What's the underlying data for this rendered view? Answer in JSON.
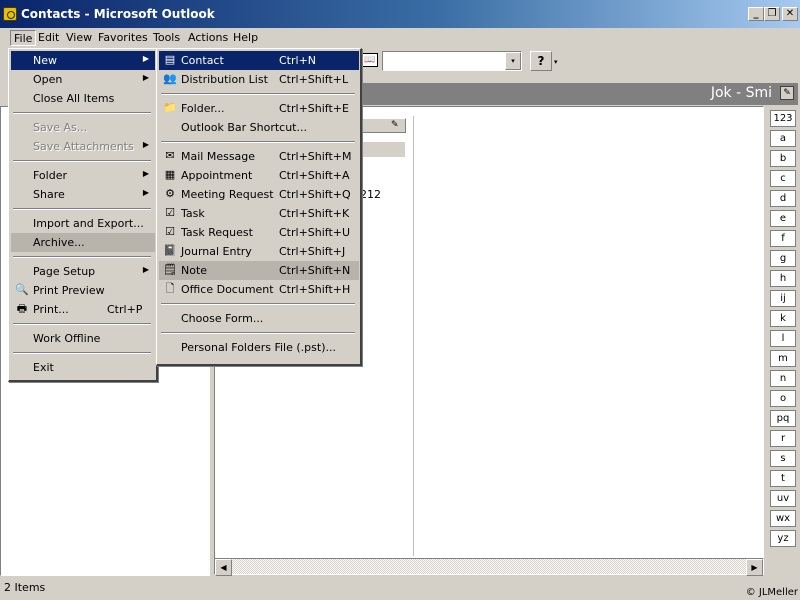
{
  "window": {
    "title": "Contacts - Microsoft Outlook",
    "min": "_",
    "max": "❐",
    "close": "✕"
  },
  "menubar": [
    "File",
    "Edit",
    "View",
    "Favorites",
    "Tools",
    "Actions",
    "Help"
  ],
  "toolbar": {
    "dropdown_arrow": "▾"
  },
  "banner": {
    "title": "Jok - Smi"
  },
  "card": {
    "phone": "212"
  },
  "index": [
    "123",
    "a",
    "b",
    "c",
    "d",
    "e",
    "f",
    "g",
    "h",
    "ij",
    "k",
    "l",
    "m",
    "n",
    "o",
    "pq",
    "r",
    "s",
    "t",
    "uv",
    "wx",
    "yz"
  ],
  "scroll": {
    "left": "◀",
    "right": "▶"
  },
  "status": {
    "items": "2 Items",
    "copyright": "© JLMeller"
  },
  "file_menu": [
    {
      "label": "New",
      "arrow": true,
      "highlight": true
    },
    {
      "label": "Open",
      "arrow": true
    },
    {
      "label": "Close All Items"
    },
    {
      "sep": true
    },
    {
      "label": "Save As...",
      "disabled": true
    },
    {
      "label": "Save Attachments",
      "disabled": true,
      "arrow": true
    },
    {
      "sep": true
    },
    {
      "label": "Folder",
      "arrow": true
    },
    {
      "label": "Share",
      "arrow": true
    },
    {
      "sep": true
    },
    {
      "label": "Import and Export..."
    },
    {
      "label": "Archive...",
      "sel": true
    },
    {
      "sep": true
    },
    {
      "label": "Page Setup",
      "arrow": true
    },
    {
      "label": "Print Preview",
      "icon": "print-preview-icon"
    },
    {
      "label": "Print...",
      "shortcut": "Ctrl+P",
      "icon": "printer-icon"
    },
    {
      "sep": true
    },
    {
      "label": "Work Offline"
    },
    {
      "sep": true
    },
    {
      "label": "Exit"
    }
  ],
  "new_menu": [
    {
      "label": "Contact",
      "shortcut": "Ctrl+N",
      "icon": "contact-card-icon",
      "hl": true
    },
    {
      "label": "Distribution List",
      "shortcut": "Ctrl+Shift+L",
      "icon": "distribution-list-icon"
    },
    {
      "sep": true
    },
    {
      "label": "Folder...",
      "shortcut": "Ctrl+Shift+E",
      "icon": "folder-icon"
    },
    {
      "label": "Outlook Bar Shortcut..."
    },
    {
      "sep": true
    },
    {
      "label": "Mail Message",
      "shortcut": "Ctrl+Shift+M",
      "icon": "mail-icon"
    },
    {
      "label": "Appointment",
      "shortcut": "Ctrl+Shift+A",
      "icon": "calendar-icon"
    },
    {
      "label": "Meeting Request",
      "shortcut": "Ctrl+Shift+Q",
      "icon": "meeting-icon"
    },
    {
      "label": "Task",
      "shortcut": "Ctrl+Shift+K",
      "icon": "task-check-icon"
    },
    {
      "label": "Task Request",
      "shortcut": "Ctrl+Shift+U",
      "icon": "task-request-icon"
    },
    {
      "label": "Journal Entry",
      "shortcut": "Ctrl+Shift+J",
      "icon": "journal-icon"
    },
    {
      "label": "Note",
      "shortcut": "Ctrl+Shift+N",
      "icon": "note-icon",
      "sel": true
    },
    {
      "label": "Office Document",
      "shortcut": "Ctrl+Shift+H",
      "icon": "document-icon"
    },
    {
      "sep": true
    },
    {
      "label": "Choose Form..."
    },
    {
      "sep": true
    },
    {
      "label": "Personal Folders File (.pst)..."
    }
  ]
}
